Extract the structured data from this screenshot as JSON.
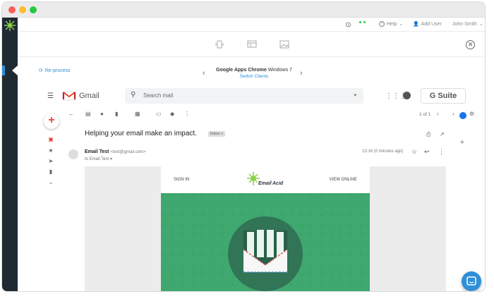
{
  "window": {
    "traffic_lights": [
      "#ff5f57",
      "#febc2e",
      "#28c840"
    ]
  },
  "topbar": {
    "help_label": "Help",
    "add_user_label": "Add User",
    "user_name": "John Smith"
  },
  "clientbar": {
    "reprocess_label": "Re-process",
    "client_name_bold": "Google Apps Chrome",
    "client_version": "Windows 7",
    "switch_label": "Switch Clients"
  },
  "gmail": {
    "app_name": "Gmail",
    "search_placeholder": "Search mail",
    "gsuite_label": "G Suite",
    "pager_text": "1 of 1",
    "subject": "Helping your email make an impact.",
    "inbox_tag": "Inbox",
    "sender_name": "Email Test",
    "sender_addr": "<test@gmail.com>",
    "to_line": "to Email Test",
    "timestamp": "13:16 (0 minutes ago)"
  },
  "email_preview": {
    "sign_in": "SIGN IN",
    "view_online": "VIEW ONLINE",
    "brand": "Email on Acid"
  },
  "colors": {
    "accent": "#2f8fd8",
    "sidebar": "#1f2a33",
    "hero_green": "#3fa86f"
  }
}
